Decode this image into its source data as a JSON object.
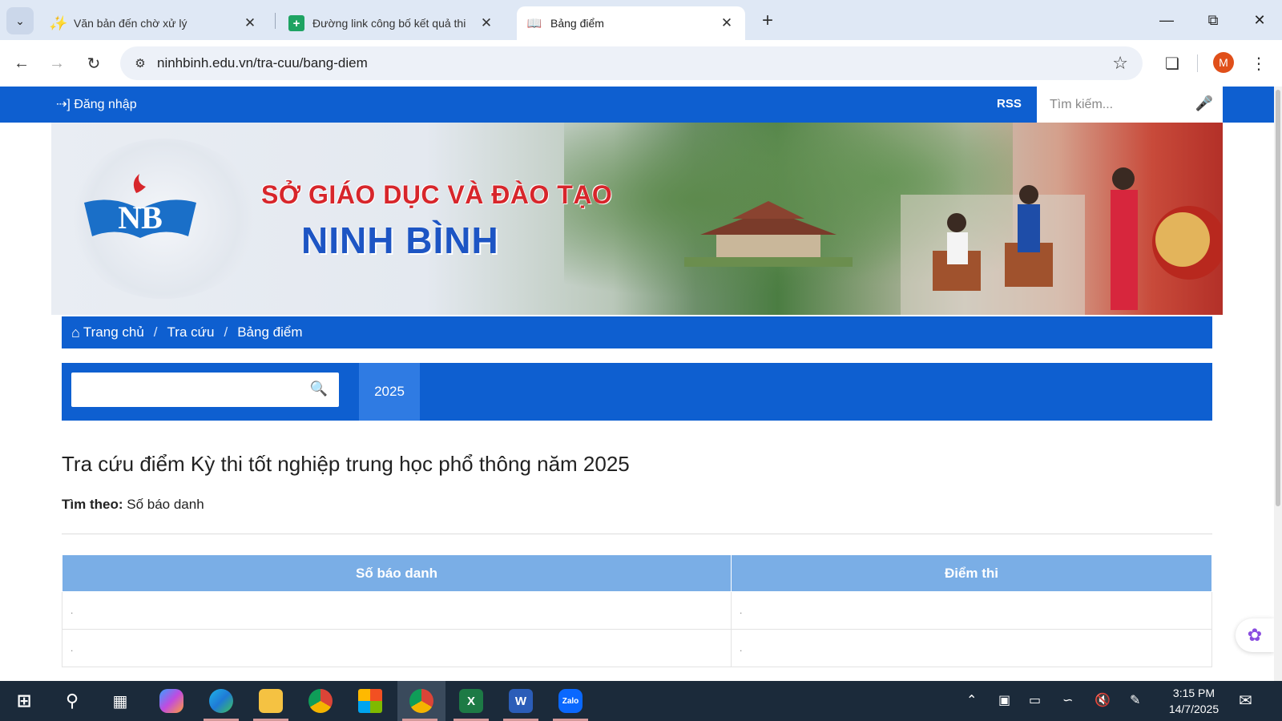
{
  "browser": {
    "tabs": [
      {
        "title": "Văn bản đến chờ xử lý",
        "icon": "vnpt-icon",
        "active": false
      },
      {
        "title": "Đường link công bố kết quả thi",
        "icon": "google-sheets-icon",
        "active": false
      },
      {
        "title": "Bảng điểm",
        "icon": "reader-book-icon",
        "active": true
      }
    ],
    "url": "ninhbinh.edu.vn/tra-cuu/bang-diem",
    "profile_initial": "M"
  },
  "site": {
    "login_label": "Đăng nhập",
    "rss_label": "RSS",
    "search_placeholder": "Tìm kiếm...",
    "banner": {
      "logo_text": "NB",
      "line1": "SỞ GIÁO DỤC VÀ ĐÀO TẠO",
      "line2": "NINH BÌNH"
    },
    "breadcrumb": [
      "Trang chủ",
      "Tra cứu",
      "Bảng điểm"
    ],
    "filter": {
      "search_value": "",
      "year_tab": "2025"
    },
    "page_title": "Tra cứu điểm Kỳ thi tốt nghiệp trung học phổ thông năm 2025",
    "search_by_label": "Tìm theo:",
    "search_by_value": "Số báo danh",
    "table": {
      "headers": [
        "Số báo danh",
        "Điểm thi"
      ],
      "rows": [
        [
          ".",
          "."
        ],
        [
          ".",
          "."
        ]
      ]
    }
  },
  "taskbar": {
    "apps": [
      "windows-start-icon",
      "search-icon",
      "task-view-icon",
      "copilot-icon",
      "edge-icon",
      "file-explorer-icon",
      "chrome-icon",
      "microsoft-store-icon",
      "chrome-profile-icon",
      "excel-icon",
      "word-icon",
      "zalo-icon"
    ],
    "zalo_label": "Zalo",
    "time": "3:15 PM",
    "date": "14/7/2025"
  },
  "colors": {
    "site_blue": "#0e5fd0",
    "table_header": "#7aaee6",
    "year_tab": "#2f7be3",
    "tabstrip": "#dfe8f5"
  }
}
